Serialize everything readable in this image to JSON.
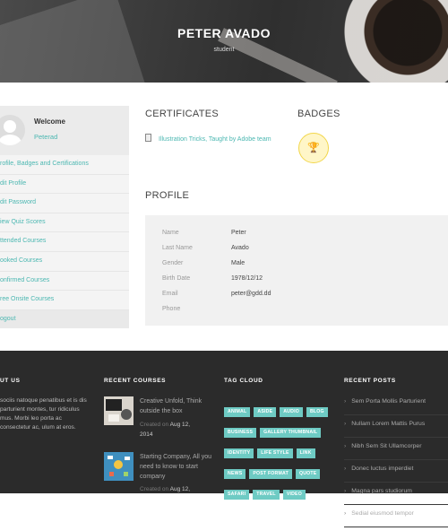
{
  "hero": {
    "title": "PETER AVADO",
    "subtitle": "student"
  },
  "sidebar": {
    "welcome": "Welcome",
    "username": "Peterad",
    "items": [
      "rofile, Badges and Certifications",
      "dit Profile",
      "dit Password",
      "iew Quiz Scores",
      "ttended Courses",
      "ooked Courses",
      "onfirmed Courses",
      "ree Onsite Courses",
      "ogout"
    ]
  },
  "certificates": {
    "heading": "CERTIFICATES",
    "items": [
      "Illustration Tricks, Taught by Adobe team"
    ]
  },
  "badges": {
    "heading": "BADGES",
    "badge_icon": "trophy-icon",
    "badge_color": "#f2d64a"
  },
  "profile": {
    "heading": "PROFILE",
    "fields": [
      {
        "label": "Name",
        "value": "Peter"
      },
      {
        "label": "Last Name",
        "value": "Avado"
      },
      {
        "label": "Gender",
        "value": "Male"
      },
      {
        "label": "Birth Date",
        "value": "1978/12/12"
      },
      {
        "label": "Email",
        "value": "peter@gdd.dd"
      },
      {
        "label": "Phone",
        "value": ""
      }
    ]
  },
  "footer": {
    "about": {
      "heading": "UT US",
      "text": "sociis natoque penatibus et is dis parturient montes, tur ridiculus mus. Morbi leo porta ac consectetur ac, ulum at eros."
    },
    "recent_courses": {
      "heading": "RECENT COURSES",
      "items": [
        {
          "title": "Creative Unfold, Think outside the box",
          "created_label": "Created on",
          "date": "Aug 12,",
          "year": "2014"
        },
        {
          "title": "Starting Company, All you need to know to start company",
          "created_label": "Created on",
          "date": "Aug 12,",
          "year": ""
        }
      ]
    },
    "tag_cloud": {
      "heading": "TAG CLOUD",
      "tags": [
        "ANIMAL",
        "ASIDE",
        "AUDIO",
        "BLOG",
        "BUSINESS",
        "GALLERY THUMBNAIL",
        "IDENTITY",
        "LIFE STYLE",
        "LINK",
        "NEWS",
        "POST FORMAT",
        "QUOTE",
        "SAFARI",
        "TRAVEL",
        "VIDEO"
      ]
    },
    "recent_posts": {
      "heading": "RECENT POSTS",
      "items": [
        "Sem Porta Mollis Parturient",
        "Nullam Lorem Mattis Purus",
        "Nibh Sem Sit Ullamcorper",
        "Donec luctus imperdiet",
        "Magna pars studiorum",
        "Sedial eiusmod tempor"
      ]
    }
  },
  "colors": {
    "accent": "#4bb7b1",
    "tag": "#6ecbc4",
    "footer_bg": "#2b2b2b"
  }
}
